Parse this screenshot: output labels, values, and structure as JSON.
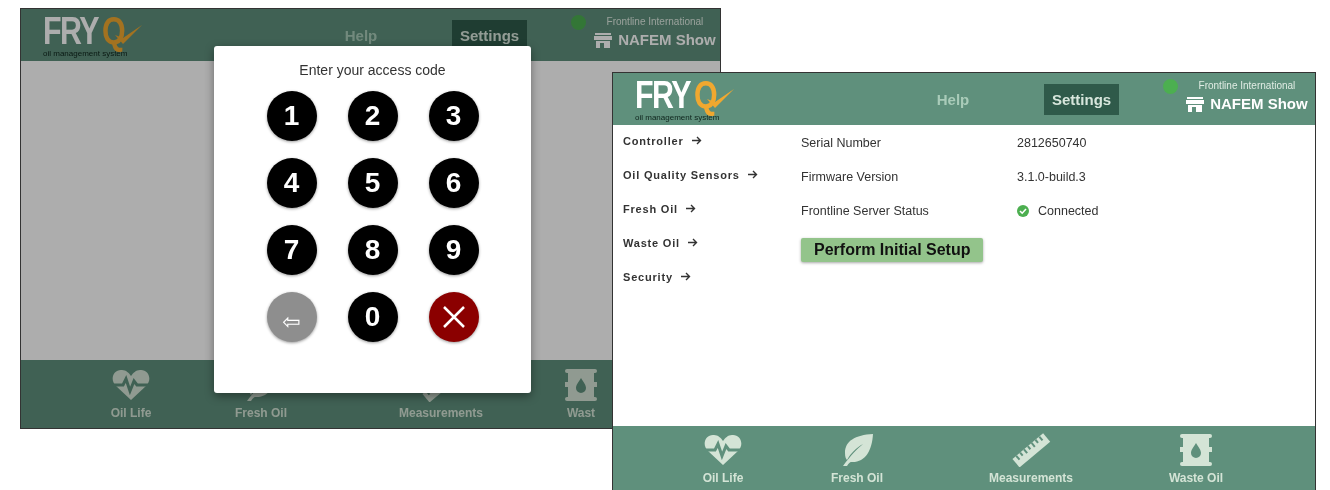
{
  "screens": [
    {
      "logo": {
        "wordmark": "FRY",
        "accent": "Q",
        "tagline": "oil management system"
      },
      "nav": [
        {
          "label": "Help",
          "selected": false
        },
        {
          "label": "Settings",
          "selected": true
        }
      ],
      "account": {
        "organization": "Frontline International",
        "store": "NAFEM Show"
      },
      "content": {
        "kind": "blank"
      },
      "footer_tabs": [
        {
          "label": "Oil Life"
        },
        {
          "label": "Fresh Oil"
        },
        {
          "label": "Measurements"
        },
        {
          "label": "Wast"
        }
      ],
      "dialog": {
        "title": "Enter your access code",
        "keys": [
          {
            "kind": "digit",
            "label": "1"
          },
          {
            "kind": "digit",
            "label": "2"
          },
          {
            "kind": "digit",
            "label": "3"
          },
          {
            "kind": "digit",
            "label": "4"
          },
          {
            "kind": "digit",
            "label": "5"
          },
          {
            "kind": "digit",
            "label": "6"
          },
          {
            "kind": "digit",
            "label": "7"
          },
          {
            "kind": "digit",
            "label": "8"
          },
          {
            "kind": "digit",
            "label": "9"
          },
          {
            "kind": "backspace",
            "label": "⇦"
          },
          {
            "kind": "digit",
            "label": "0"
          },
          {
            "kind": "cancel"
          }
        ]
      }
    },
    {
      "logo": {
        "wordmark": "FRY",
        "accent": "Q",
        "tagline": "oil management system"
      },
      "nav": [
        {
          "label": "Help",
          "selected": false
        },
        {
          "label": "Settings",
          "selected": true
        }
      ],
      "account": {
        "organization": "Frontline International",
        "store": "NAFEM Show"
      },
      "content": {
        "kind": "settings",
        "menu": [
          "Controller",
          "Oil Quality Sensors",
          "Fresh Oil",
          "Waste Oil",
          "Security"
        ],
        "info_rows": [
          {
            "label": "Serial Number",
            "value": "2812650740"
          },
          {
            "label": "Firmware Version",
            "value": "3.1.0-build.3"
          }
        ],
        "server_status": {
          "label": "Frontline Server Status",
          "value": "Connected",
          "connected": true
        },
        "action": "Perform Initial Setup"
      },
      "footer_tabs": [
        {
          "label": "Oil Life"
        },
        {
          "label": "Fresh Oil"
        },
        {
          "label": "Measurements"
        },
        {
          "label": "Waste Oil"
        }
      ]
    }
  ]
}
